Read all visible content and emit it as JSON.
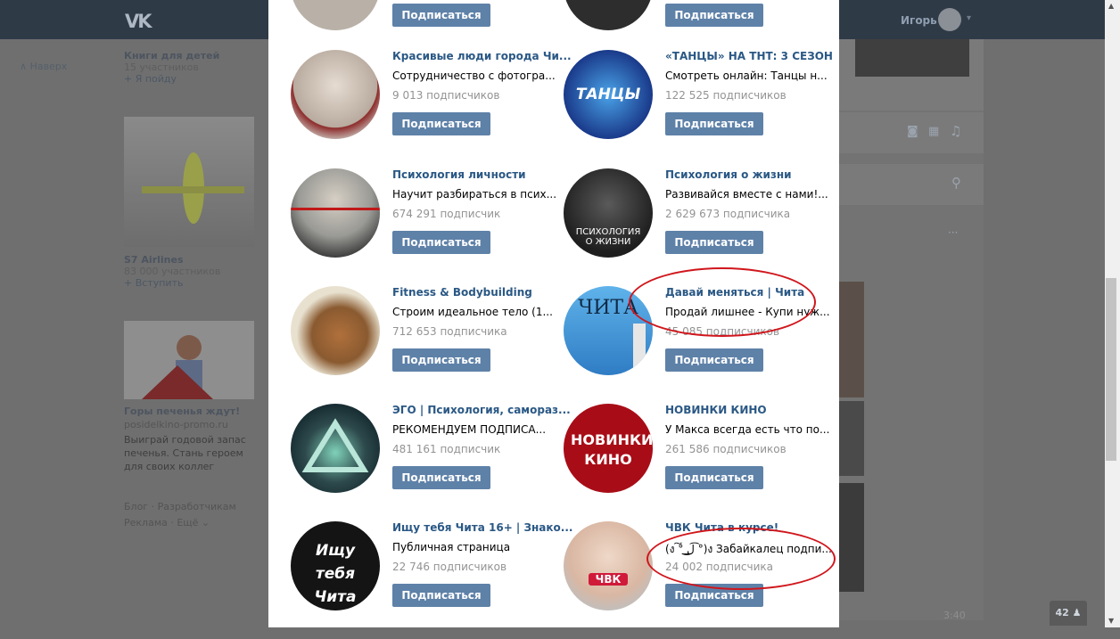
{
  "topbar": {
    "logo": "VK",
    "user_name": "Игорь"
  },
  "left": {
    "back_label": "Наверх",
    "event": {
      "title": "Книги для детей",
      "sub": "15 участников",
      "action": "+ Я пойду"
    },
    "group": {
      "title": "S7 Airlines",
      "sub": "83 000 участников",
      "action": "+ Вступить"
    },
    "ad": {
      "title": "Горы печенья ждут!",
      "url": "posidelkino-promo.ru",
      "text": "Выиграй годовой запас печенья. Стань героем для своих коллег"
    },
    "footer": {
      "blog": "Блог",
      "dev": "Разработчикам",
      "ads": "Реклама",
      "more": "Ещё ⌄"
    }
  },
  "right": {
    "time": "3:40",
    "online_count": "42"
  },
  "cards": [
    {
      "name": "",
      "desc": "",
      "subs": "",
      "button": "Подписаться"
    },
    {
      "name": "",
      "desc": "",
      "subs": "",
      "button": "Подписаться"
    },
    {
      "name": "Красивые люди города Чи...",
      "desc": "Сотрудничество с фотогра...",
      "subs": "9 013 подписчиков",
      "button": "Подписаться",
      "avatar_color": "#c9c2bb"
    },
    {
      "name": "«ТАНЦЫ» НА ТНТ: 3 СЕЗОН",
      "desc": "Смотреть онлайн: Танцы н...",
      "subs": "122 525 подписчиков",
      "button": "Подписаться",
      "avatar_color": "#1a3a8a",
      "avatar_label": "ТАНЦЫ"
    },
    {
      "name": "Психология личности",
      "desc": "Научит разбираться в псих...",
      "subs": "674 291 подписчик",
      "button": "Подписаться",
      "avatar_color": "#9a9a96"
    },
    {
      "name": "Психология о жизни",
      "desc": "Развивайся вместе с нами!...",
      "subs": "2 629 673 подписчика",
      "button": "Подписаться",
      "avatar_color": "#2b2b2b",
      "avatar_label": "ПСИХОЛОГИЯ О ЖИЗНИ"
    },
    {
      "name": "Fitness & Bodybuilding",
      "desc": "Строим идеальное тело (1...",
      "subs": "712 653 подписчика",
      "button": "Подписаться",
      "avatar_color": "#d8c8a8"
    },
    {
      "name": "Давай меняться | Чита",
      "desc": "Продай лишнее - Купи нуж...",
      "subs": "45 085 подписчиков",
      "button": "Подписаться",
      "avatar_color": "#3d8fd6",
      "avatar_label": "ЧИТА"
    },
    {
      "name": "ЭГО | Психология, самораз...",
      "desc": "РЕКОМЕНДУЕМ ПОДПИСА...",
      "subs": "481 161 подписчик",
      "button": "Подписаться",
      "avatar_color": "#2e4a4c"
    },
    {
      "name": "НОВИНКИ КИНО",
      "desc": "У Макса всегда есть что по...",
      "subs": "261 586 подписчиков",
      "button": "Подписаться",
      "avatar_color": "#b0101a",
      "avatar_label": "НОВИНКИ КИНО"
    },
    {
      "name": "Ищу тебя Чита 16+ | Знако...",
      "desc": "Публичная страница",
      "subs": "22 746 подписчиков",
      "button": "Подписаться",
      "avatar_color": "#141414",
      "avatar_label": "Ищу тебя Чита 16+"
    },
    {
      "name": "ЧВК Чита в курсе!",
      "desc": "(ง ͠° ͟ل͜ ͡°)ง Забайкалец подпи...",
      "subs": "24 002 подписчика",
      "button": "Подписаться",
      "avatar_color": "#d9b7a3",
      "avatar_label": "ЧВК"
    }
  ]
}
